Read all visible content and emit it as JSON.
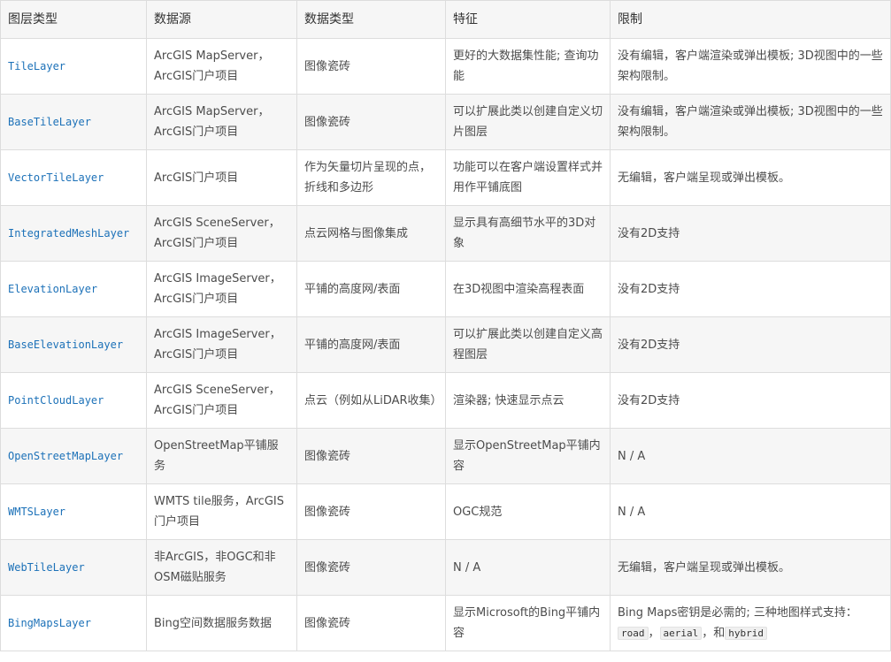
{
  "headers": [
    "图层类型",
    "数据源",
    "数据类型",
    "特征",
    "限制"
  ],
  "rows": [
    {
      "layer": "TileLayer",
      "source": "ArcGIS MapServer，ArcGIS门户项目",
      "datatype": "图像瓷砖",
      "feature": "更好的大数据集性能; 查询功能",
      "limit": "没有编辑，客户端渲染或弹出模板; 3D视图中的一些架构限制。"
    },
    {
      "layer": "BaseTileLayer",
      "source": "ArcGIS MapServer，ArcGIS门户项目",
      "datatype": "图像瓷砖",
      "feature": "可以扩展此类以创建自定义切片图层",
      "limit": "没有编辑，客户端渲染或弹出模板; 3D视图中的一些架构限制。"
    },
    {
      "layer": "VectorTileLayer",
      "source": "ArcGIS门户项目",
      "datatype": "作为矢量切片呈现的点，折线和多边形",
      "feature": "功能可以在客户端设置样式并用作平铺底图",
      "limit": "无编辑，客户端呈现或弹出模板。"
    },
    {
      "layer": "IntegratedMeshLayer",
      "source": "ArcGIS SceneServer，ArcGIS门户项目",
      "datatype": "点云网格与图像集成",
      "feature": "显示具有高细节水平的3D对象",
      "limit": "没有2D支持"
    },
    {
      "layer": "ElevationLayer",
      "source": "ArcGIS ImageServer，ArcGIS门户项目",
      "datatype": "平铺的高度网/表面",
      "feature": "在3D视图中渲染高程表面",
      "limit": "没有2D支持"
    },
    {
      "layer": "BaseElevationLayer",
      "source": "ArcGIS ImageServer，ArcGIS门户项目",
      "datatype": "平铺的高度网/表面",
      "feature": "可以扩展此类以创建自定义高程图层",
      "limit": "没有2D支持"
    },
    {
      "layer": "PointCloudLayer",
      "source": "ArcGIS SceneServer，ArcGIS门户项目",
      "datatype": "点云（例如从LiDAR收集）",
      "feature": "渲染器; 快速显示点云",
      "limit": "没有2D支持"
    },
    {
      "layer": "OpenStreetMapLayer",
      "source": "OpenStreetMap平铺服务",
      "datatype": "图像瓷砖",
      "feature": "显示OpenStreetMap平铺内容",
      "limit": "N / A"
    },
    {
      "layer": "WMTSLayer",
      "source": "WMTS tile服务，ArcGIS门户项目",
      "datatype": "图像瓷砖",
      "feature": "OGC规范",
      "limit": "N / A"
    },
    {
      "layer": "WebTileLayer",
      "source": "非ArcGIS，非OGC和非OSM磁贴服务",
      "datatype": "图像瓷砖",
      "feature": "N / A",
      "limit": "无编辑，客户端呈现或弹出模板。"
    }
  ],
  "last_row": {
    "layer": "BingMapsLayer",
    "source": "Bing空间数据服务数据",
    "datatype": "图像瓷砖",
    "feature": "显示Microsoft的Bing平铺内容",
    "limit_prefix": "Bing Maps密钥是必需的; 三种地图样式支持：",
    "code_road": "road",
    "sep1": "，",
    "code_aerial": "aerial",
    "sep2": "，和",
    "code_hybrid": "hybrid"
  },
  "colors": {
    "link": "#1c71b8",
    "header_bg": "#f6f6f6",
    "border": "#dddddd"
  }
}
